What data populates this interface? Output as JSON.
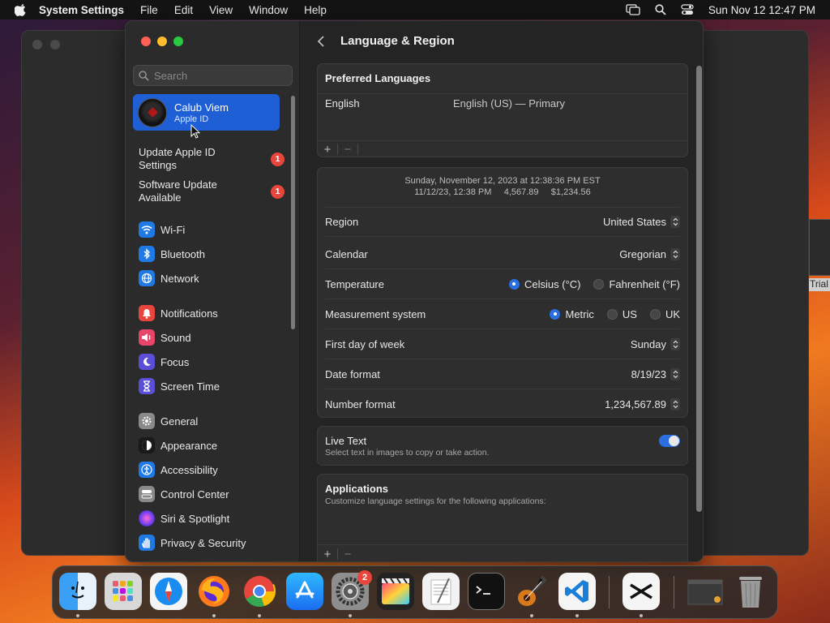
{
  "menubar": {
    "app_name": "System Settings",
    "menus": [
      "File",
      "Edit",
      "View",
      "Window",
      "Help"
    ],
    "clock": "Sun Nov 12  12:47 PM"
  },
  "sidebar": {
    "search_placeholder": "Search",
    "account": {
      "name": "Calub Viem",
      "subtitle": "Apple ID"
    },
    "notices": [
      {
        "label": "Update Apple ID Settings",
        "badge": "1"
      },
      {
        "label": "Software Update Available",
        "badge": "1"
      }
    ],
    "items": [
      {
        "label": "Wi-Fi",
        "icon": "wifi-icon",
        "color": "#1f7ae6"
      },
      {
        "label": "Bluetooth",
        "icon": "bluetooth-icon",
        "color": "#1f7ae6"
      },
      {
        "label": "Network",
        "icon": "globe-icon",
        "color": "#1f7ae6"
      },
      {
        "label": "Notifications",
        "icon": "bell-icon",
        "color": "#e8453c"
      },
      {
        "label": "Sound",
        "icon": "speaker-icon",
        "color": "#e8456a"
      },
      {
        "label": "Focus",
        "icon": "moon-icon",
        "color": "#5a4fd6"
      },
      {
        "label": "Screen Time",
        "icon": "hourglass-icon",
        "color": "#5a4fd6"
      },
      {
        "label": "General",
        "icon": "gear-icon",
        "color": "#8a8a8a"
      },
      {
        "label": "Appearance",
        "icon": "appearance-icon",
        "color": "#1a1a1a"
      },
      {
        "label": "Accessibility",
        "icon": "accessibility-icon",
        "color": "#1f7ae6"
      },
      {
        "label": "Control Center",
        "icon": "control-center-icon",
        "color": "#8a8a8a"
      },
      {
        "label": "Siri & Spotlight",
        "icon": "siri-icon",
        "color": "#c040c0"
      },
      {
        "label": "Privacy & Security",
        "icon": "hand-icon",
        "color": "#1f7ae6"
      }
    ]
  },
  "content": {
    "title": "Language & Region",
    "preferred_languages": {
      "header": "Preferred Languages",
      "language": "English",
      "language_detail": "English (US) — Primary"
    },
    "preview": {
      "line1": "Sunday, November 12, 2023 at 12:38:36 PM EST",
      "line2": "11/12/23, 12:38 PM     4,567.89     $1,234.56"
    },
    "settings": {
      "region": {
        "label": "Region",
        "value": "United States"
      },
      "calendar": {
        "label": "Calendar",
        "value": "Gregorian"
      },
      "temperature": {
        "label": "Temperature",
        "options": [
          "Celsius (°C)",
          "Fahrenheit (°F)"
        ],
        "selected": "Celsius (°C)"
      },
      "measurement": {
        "label": "Measurement system",
        "options": [
          "Metric",
          "US",
          "UK"
        ],
        "selected": "Metric"
      },
      "first_day": {
        "label": "First day of week",
        "value": "Sunday"
      },
      "date_format": {
        "label": "Date format",
        "value": "8/19/23"
      },
      "number_format": {
        "label": "Number format",
        "value": "1,234,567.89"
      }
    },
    "live_text": {
      "title": "Live Text",
      "description": "Select text in images to copy or take action.",
      "enabled": true
    },
    "applications": {
      "title": "Applications",
      "description": "Customize language settings for the following applications:"
    },
    "add_symbol": "+",
    "remove_symbol": "−"
  },
  "background": {
    "trial_text": "Trial"
  },
  "dock": {
    "settings_badge": "2",
    "apps": [
      "finder-icon",
      "launchpad-icon",
      "safari-icon",
      "firefox-icon",
      "chrome-icon",
      "app-store-icon",
      "system-settings-icon",
      "final-cut-icon",
      "textedit-icon",
      "terminal-icon",
      "garageband-icon",
      "vscode-icon",
      "capcut-icon",
      "downloads-icon",
      "trash-icon"
    ]
  },
  "colors": {
    "accent": "#2a6ee0",
    "selection": "#1f5fd6",
    "badge": "#e8453c"
  }
}
